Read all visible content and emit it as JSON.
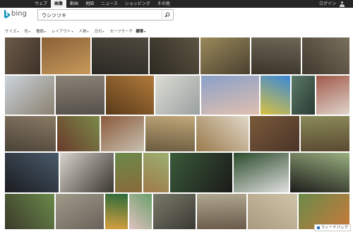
{
  "nav": {
    "items": [
      "ウェブ",
      "画像",
      "動画",
      "地図",
      "ニュース",
      "ショッピング",
      "その他"
    ],
    "active_index": 1
  },
  "header": {
    "signin": "ログイン",
    "logo_text": "bing",
    "logo_color": "#0a8fc0"
  },
  "search": {
    "value": "ウシツツキ"
  },
  "filters": {
    "items": [
      "サイズ",
      "色",
      "種類",
      "レイアウト",
      "人物",
      "日付",
      "セーフサーチ"
    ],
    "safesearch_value": "標準"
  },
  "feedback": {
    "label": "フィードバック"
  },
  "images": {
    "count": 40
  }
}
